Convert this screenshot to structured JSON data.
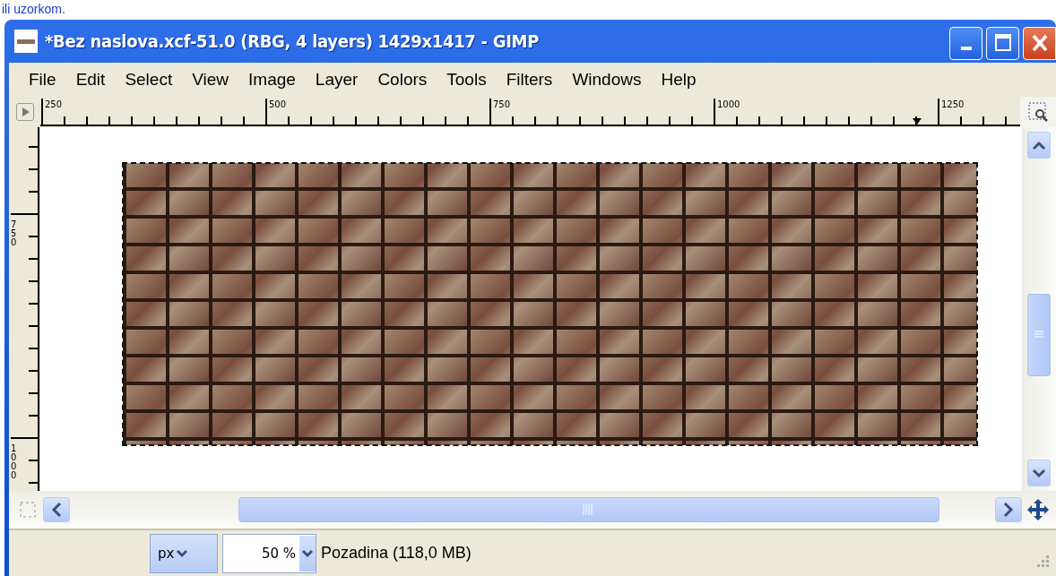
{
  "caption": "ili uzorkom.",
  "window": {
    "title": "*Bez naslova.xcf-51.0 (RBG, 4 layers) 1429x1417 - GIMP"
  },
  "menu": [
    "File",
    "Edit",
    "Select",
    "View",
    "Image",
    "Layer",
    "Colors",
    "Tools",
    "Filters",
    "Windows",
    "Help"
  ],
  "horizontal_ruler": {
    "labels": [
      "250",
      "500",
      "750",
      "1000",
      "1250"
    ]
  },
  "vertical_ruler": {
    "labels": [
      "750",
      "1000"
    ]
  },
  "status_bar": {
    "unit": "px",
    "zoom": "50 %",
    "layer_info": "Pozadina (118,0 MB)"
  }
}
